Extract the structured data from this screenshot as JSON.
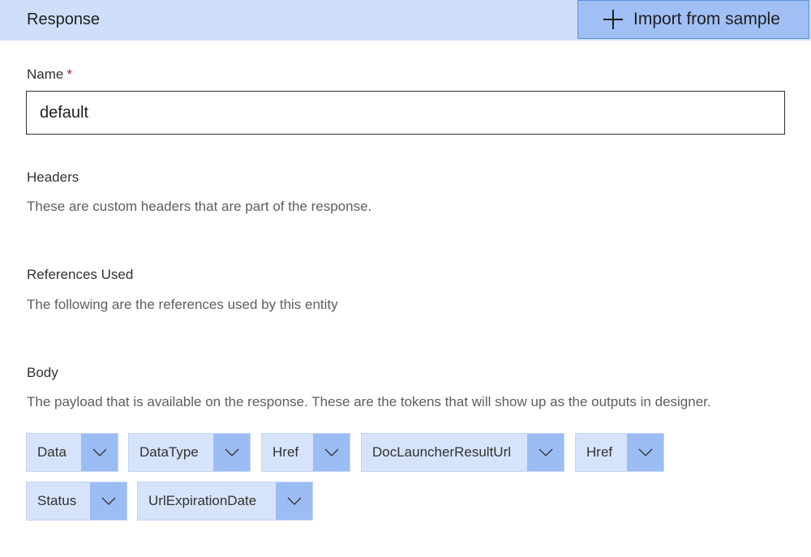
{
  "header": {
    "title": "Response",
    "import_button_label": "Import from sample"
  },
  "name_field": {
    "label": "Name",
    "required_marker": "*",
    "value": "default"
  },
  "headers_section": {
    "title": "Headers",
    "description": "These are custom headers that are part of the response."
  },
  "references_section": {
    "title": "References Used",
    "description": "The following are the references used by this entity"
  },
  "body_section": {
    "title": "Body",
    "description": "The payload that is available on the response. These are the tokens that will show up as the outputs in designer.",
    "tokens": [
      {
        "label": "Data"
      },
      {
        "label": "DataType"
      },
      {
        "label": "Href"
      },
      {
        "label": "DocLauncherResultUrl"
      },
      {
        "label": "Href"
      },
      {
        "label": "Status"
      },
      {
        "label": "UrlExpirationDate"
      }
    ]
  },
  "icons": {
    "import": "plus-icon",
    "token_expand": "chevron-down-icon"
  }
}
